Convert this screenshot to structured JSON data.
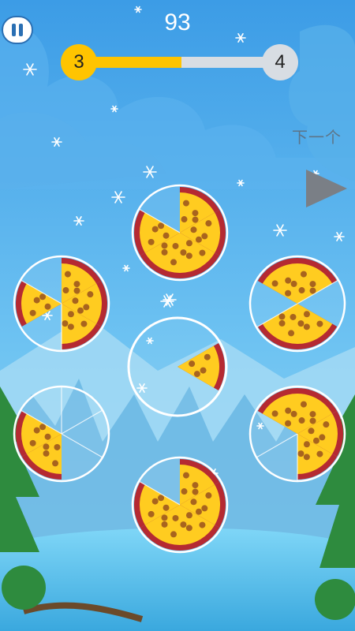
{
  "hud": {
    "score": "93",
    "level_current": "3",
    "level_next": "4",
    "level_progress": 0.52,
    "next_label": "下一个"
  },
  "icons": {
    "pause": "pause-icon",
    "next": "play-arrow-icon"
  },
  "colors": {
    "sky": "#3fa0e8",
    "cheese": "#ffcc20",
    "crust": "#b52a32",
    "topping": "#a8641e",
    "progress_fill": "#ffc400",
    "progress_track": "#d8dde3"
  },
  "board": {
    "center_plate": {
      "filled_slices": [
        1
      ]
    },
    "plates": [
      {
        "name": "top",
        "filled_slices": [
          0,
          1,
          2,
          3,
          4
        ]
      },
      {
        "name": "upper-left",
        "filled_slices": [
          0,
          1,
          2,
          4
        ]
      },
      {
        "name": "upper-right",
        "filled_slices": [
          0,
          2,
          3,
          5
        ]
      },
      {
        "name": "lower-left",
        "filled_slices": [
          3,
          4
        ]
      },
      {
        "name": "lower-right",
        "filled_slices": [
          0,
          1,
          2,
          5
        ]
      },
      {
        "name": "bottom",
        "filled_slices": [
          0,
          1,
          2,
          3,
          4
        ]
      }
    ]
  }
}
